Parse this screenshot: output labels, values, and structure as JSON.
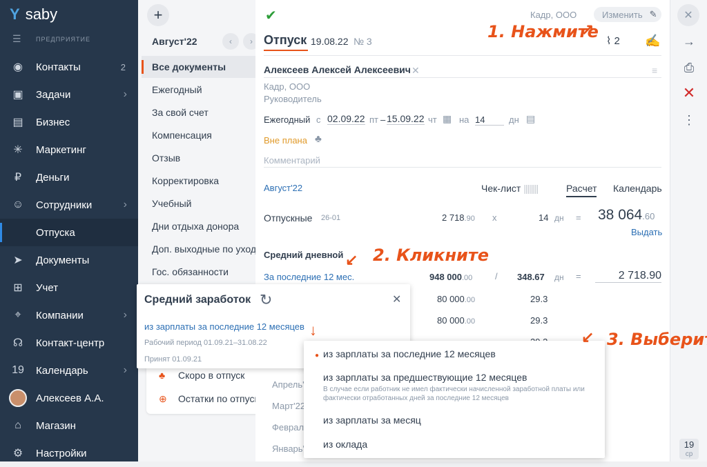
{
  "app": {
    "logo_text": "saby",
    "company_label": "ПРЕДПРИЯТИЕ"
  },
  "sidebar": {
    "items": [
      {
        "label": "Контакты",
        "badge": "2",
        "icon": "contacts-icon"
      },
      {
        "label": "Задачи",
        "chevron": "›",
        "icon": "tasks-icon"
      },
      {
        "label": "Бизнес",
        "icon": "business-icon"
      },
      {
        "label": "Маркетинг",
        "icon": "marketing-icon"
      },
      {
        "label": "Деньги",
        "icon": "money-icon"
      },
      {
        "label": "Сотрудники",
        "chevron": "›",
        "icon": "staff-icon"
      },
      {
        "label": "Отпуска",
        "selected": true
      },
      {
        "label": "Документы",
        "icon": "documents-icon"
      },
      {
        "label": "Учет",
        "icon": "accounting-icon"
      },
      {
        "label": "Компании",
        "chevron": "›",
        "icon": "companies-icon"
      },
      {
        "label": "Контакт-центр",
        "icon": "contact-center-icon"
      },
      {
        "label": "Календарь",
        "chevron": "›",
        "icon_text": "19"
      },
      {
        "label": "Алексеев А.А.",
        "icon": "avatar"
      },
      {
        "label": "Магазин",
        "icon": "shop-icon"
      },
      {
        "label": "Настройки",
        "icon": "settings-icon"
      }
    ]
  },
  "list": {
    "period": "Август'22",
    "items": [
      "Все документы",
      "Ежегодный",
      "За свой счет",
      "Компенсация",
      "Отзыв",
      "Корректировка",
      "Учебный",
      "Дни отдыха донора",
      "Доп. выходные по уходу",
      "Гос. обязанности"
    ],
    "bottom": [
      "Скоро в отпуск",
      "Остатки по отпускам"
    ],
    "months": [
      "Апрель'22",
      "Март'22",
      "Февраль'22",
      "Январь'22"
    ]
  },
  "doc": {
    "org": "Кадр, ООО",
    "edit_label": "Изменить",
    "title": "Отпуск",
    "date": "19.08.22",
    "number": "№ 3",
    "attachments": "2",
    "employee": "Алексеев Алексей Алексеевич",
    "employee_org": "Кадр, ООО",
    "employee_position": "Руководитель",
    "type": "Ежегодный",
    "from_label": "с",
    "date_from": "02.09.22",
    "day_from": "пт",
    "dash": "–",
    "date_to": "15.09.22",
    "day_to": "чт",
    "on_label": "на",
    "days": "14",
    "days_unit": "дн",
    "plan_status": "Вне плана",
    "comment_placeholder": "Комментарий"
  },
  "tabs": {
    "month": "Август'22",
    "checklist": "Чек-лист",
    "calc": "Расчет",
    "calendar": "Календарь"
  },
  "calc": {
    "row_label": "Отпускные",
    "row_code": "26-01",
    "rate": "2 718",
    "rate_dec": ".90",
    "mult": "x",
    "qty": "14",
    "qty_unit": "дн",
    "eq": "=",
    "total": "38 064",
    "total_dec": ".60",
    "pay": "Выдать",
    "avg_heading": "Средний дневной",
    "avg_link": "За последние 12 мес.",
    "avg_sum": "948 000",
    "avg_sum_dec": ".00",
    "div": "/",
    "avg_days": "348.67",
    "avg_result": "2 718.90",
    "months": [
      {
        "sum": "80 000",
        "dec": ".00",
        "days": "29.3"
      },
      {
        "sum": "80 000",
        "dec": ".00",
        "days": "29.3"
      },
      {
        "sum": "",
        "dec": "",
        "days": "29.3"
      }
    ]
  },
  "popup_avg": {
    "title": "Средний заработок",
    "link": "из зарплаты за последние 12 месяцев",
    "work_period": "Рабочий период 01.09.21–31.08.22",
    "accepted": "Принят 01.09.21"
  },
  "popup_options": {
    "options": [
      {
        "label": "из зарплаты за последние 12 месяцев",
        "selected": true
      },
      {
        "label": "из зарплаты за предшествующие 12 месяцев",
        "desc": "В случае если работник не имел фактически начисленной заработной платы или фактически отработанных дней за последние 12 месяцев"
      },
      {
        "label": "из зарплаты за месяц"
      },
      {
        "label": "из оклада"
      }
    ]
  },
  "annotations": {
    "step1": "1. Нажмите",
    "step2": "2. Кликните",
    "step3": "3. Выберите"
  },
  "rightbar": {
    "day": "19",
    "weekday": "ср"
  },
  "colors": {
    "sidebar": "#26374b",
    "accent": "#e8531a",
    "link": "#2c6fb4"
  }
}
